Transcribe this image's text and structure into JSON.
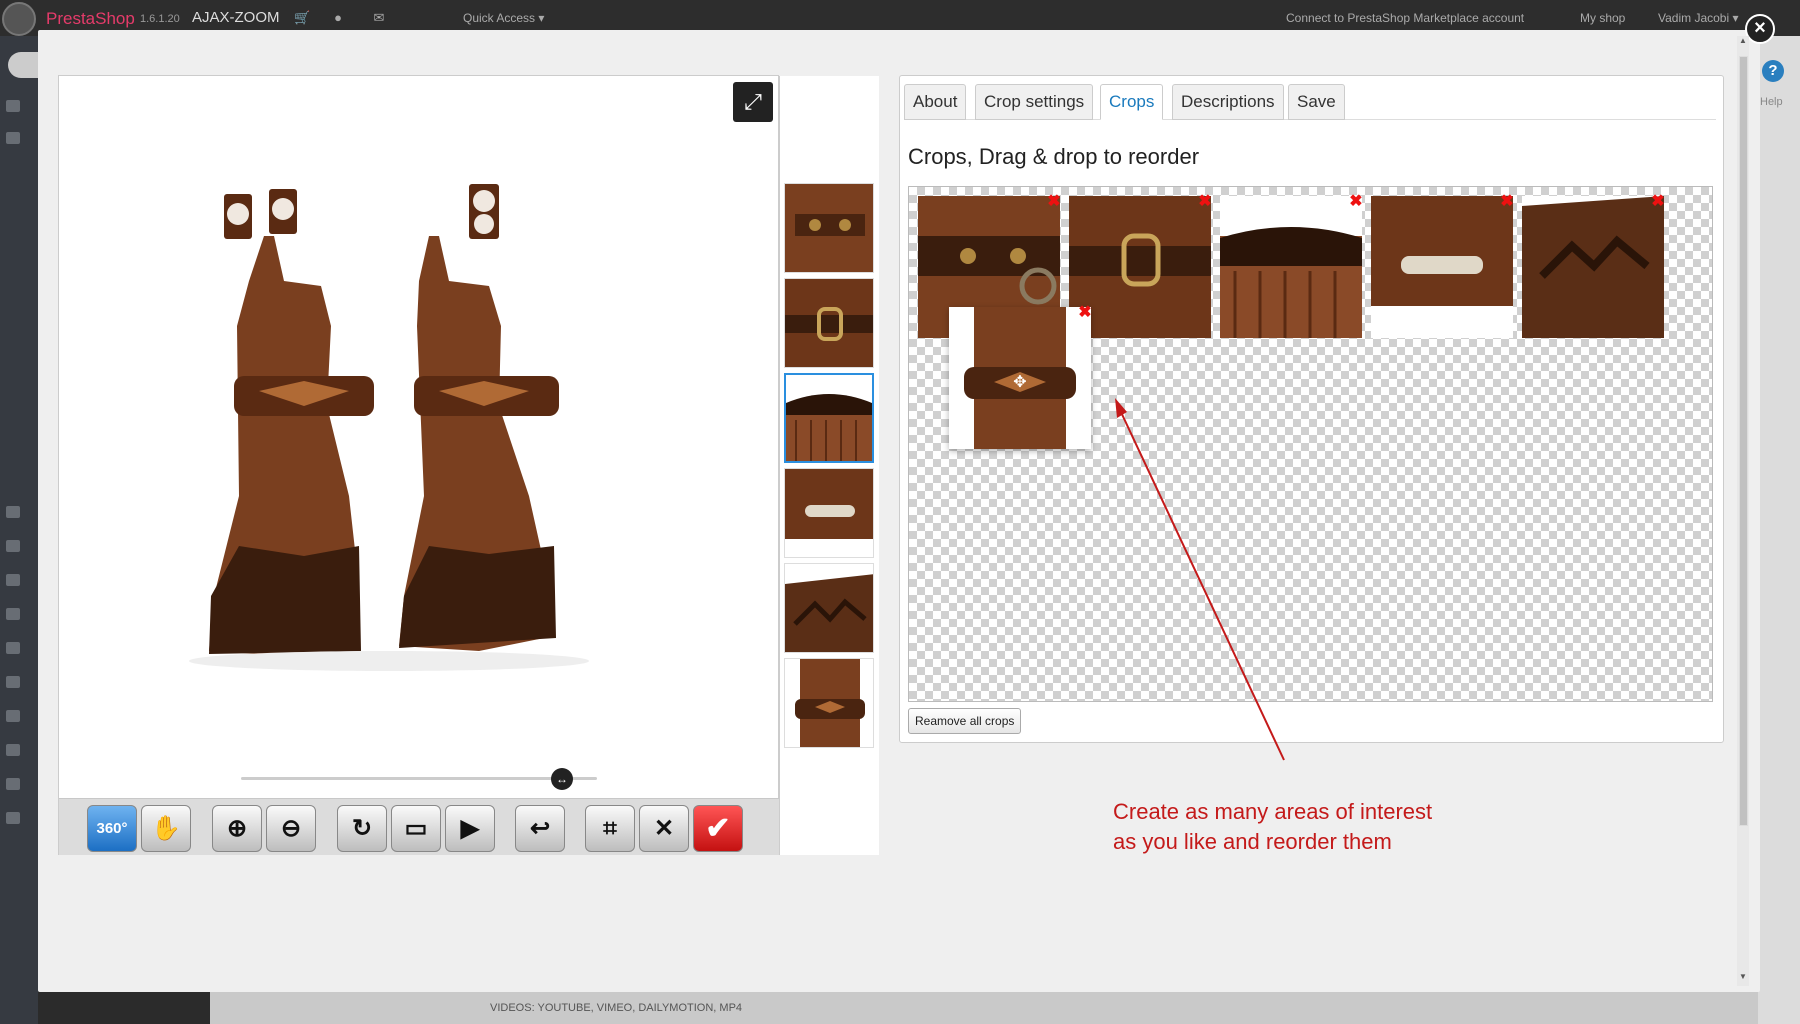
{
  "topbar": {
    "brand": "PrestaShop",
    "version": "1.6.1.20",
    "store_name": "AJAX-ZOOM",
    "quick_access": "Quick Access ▾",
    "connect": "Connect to PrestaShop Marketplace account",
    "my_shop": "My shop",
    "user": "Vadim Jacobi ▾"
  },
  "help": {
    "label": "Help",
    "glyph": "?"
  },
  "background": {
    "videos_text": "VIDEOS: YOUTUBE, VIMEO, DAILYMOTION, MP4"
  },
  "modal": {
    "close_glyph": "×"
  },
  "viewer": {
    "toolbar": {
      "btn_360": "360°"
    }
  },
  "panel": {
    "tabs": [
      {
        "label": "About"
      },
      {
        "label": "Crop settings"
      },
      {
        "label": "Crops",
        "active": true
      },
      {
        "label": "Descriptions"
      },
      {
        "label": "Save"
      }
    ],
    "title": "Crops, Drag & drop to reorder",
    "remove_all_label": "Reamove all crops"
  },
  "annotation": {
    "line1": "Create as many areas of interest",
    "line2": "as you like and reorder them",
    "color": "#c41a1a"
  },
  "colors": {
    "leather": "#7a3f1f",
    "leather_dark": "#3a1d0d",
    "accent_blue": "#1a7abd"
  }
}
